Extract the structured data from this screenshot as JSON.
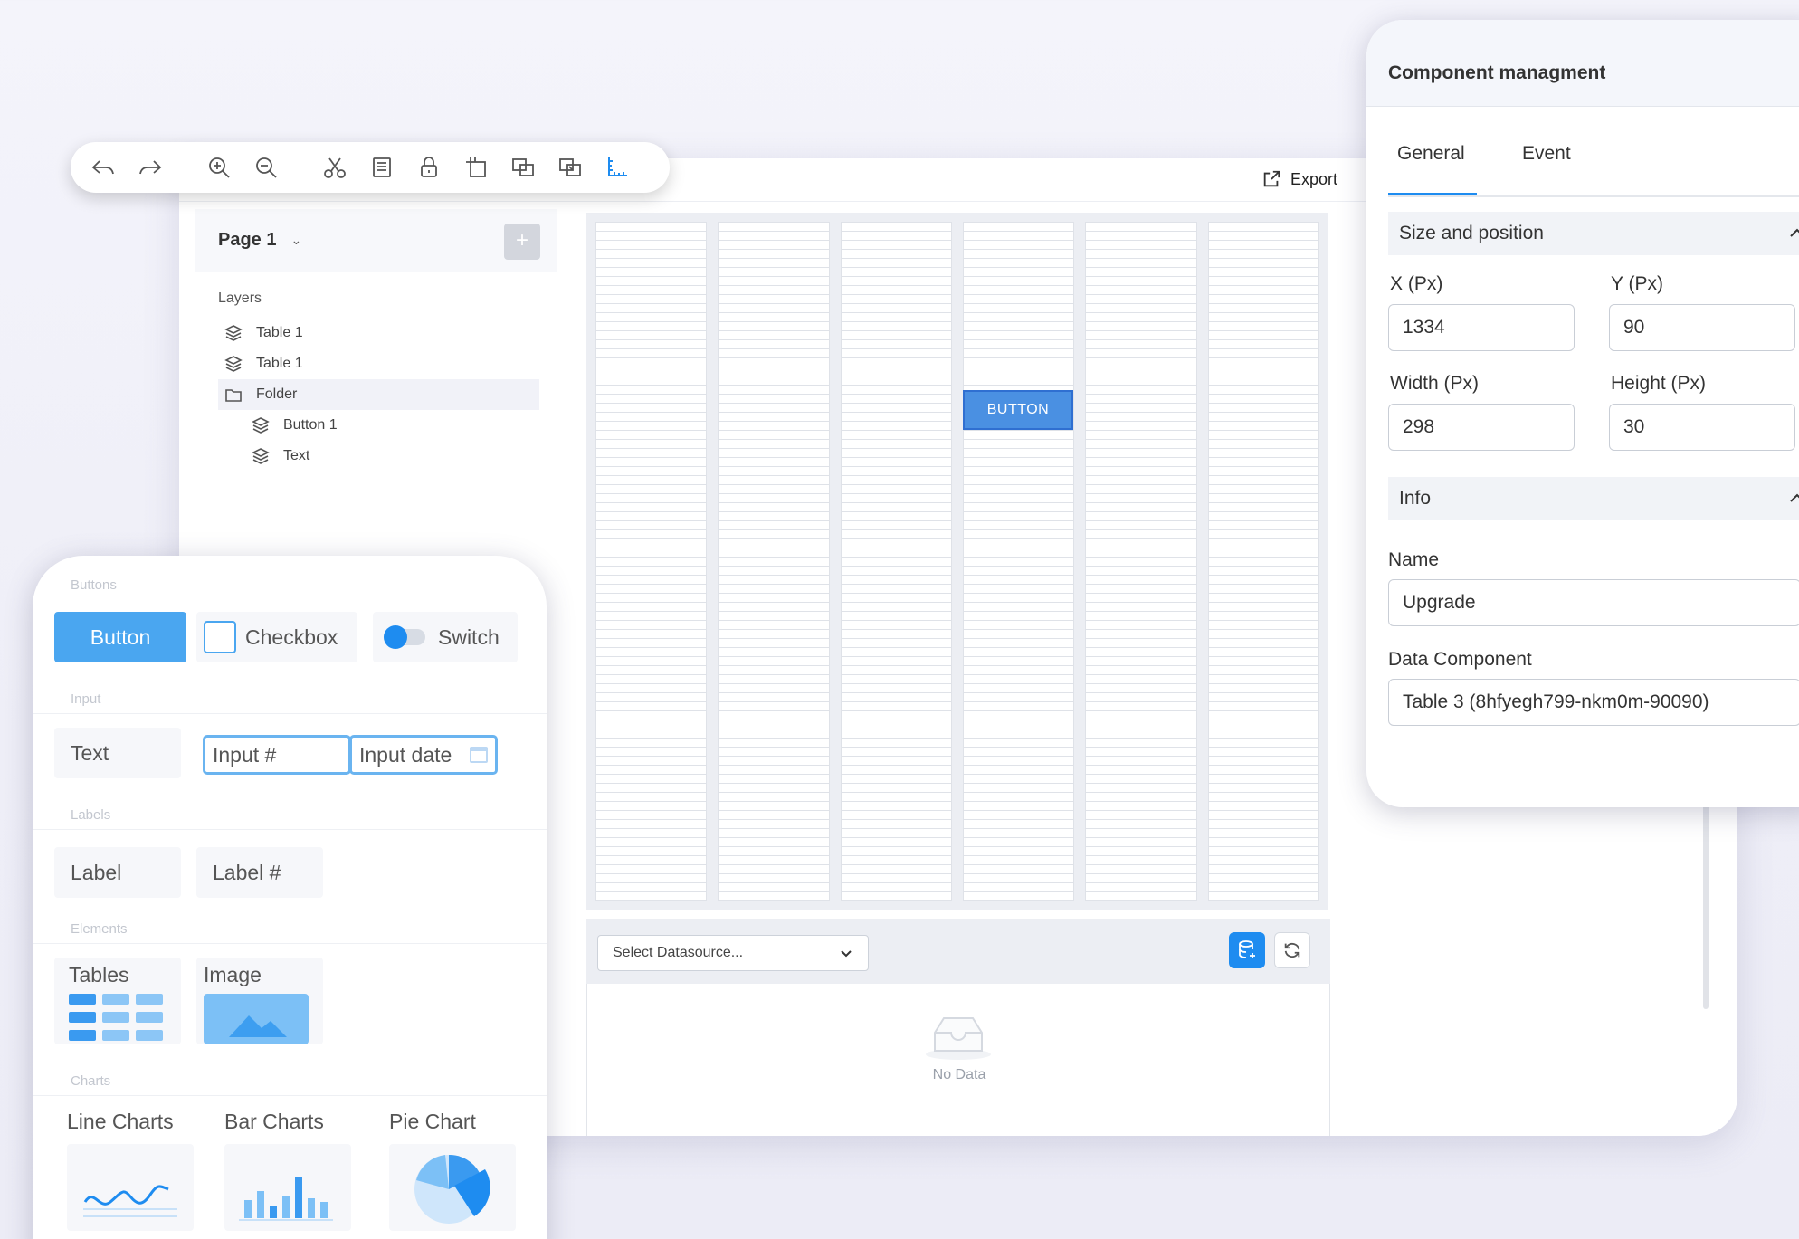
{
  "toolbar": {
    "tools": [
      "undo-icon",
      "redo-icon",
      "zoom-in-icon",
      "zoom-out-icon",
      "cut-icon",
      "notes-icon",
      "lock-icon",
      "crop-icon",
      "bring-front-icon",
      "send-back-icon",
      "ruler-icon"
    ]
  },
  "editor": {
    "export_label": "Export",
    "page_label": "Page 1",
    "layers_label": "Layers",
    "layers": [
      {
        "label": "Table 1",
        "icon": "layers-icon",
        "indent": 0,
        "selected": false
      },
      {
        "label": "Table 1",
        "icon": "layers-icon",
        "indent": 0,
        "selected": false
      },
      {
        "label": "Folder",
        "icon": "folder-icon",
        "indent": 0,
        "selected": true
      },
      {
        "label": "Button 1",
        "icon": "layers-icon",
        "indent": 1,
        "selected": false
      },
      {
        "label": "Text",
        "icon": "layers-icon",
        "indent": 1,
        "selected": false
      }
    ],
    "canvas_button": "BUTTON",
    "datasource_placeholder": "Select Datasource...",
    "no_data": "No Data"
  },
  "component_management": {
    "title": "Component managment",
    "tabs": [
      {
        "label": "General",
        "active": true
      },
      {
        "label": "Event",
        "active": false
      }
    ],
    "size_section": "Size and position",
    "x_label": "X (Px)",
    "x_value": "1334",
    "y_label": "Y (Px)",
    "y_value": "90",
    "w_label": "Width (Px)",
    "w_value": "298",
    "h_label": "Height (Px)",
    "h_value": "30",
    "info_section": "Info",
    "name_label": "Name",
    "name_value": "Upgrade",
    "data_label": "Data Component",
    "data_value": "Table 3 (8hfyegh799-nkm0m-90090)"
  },
  "palette": {
    "buttons_section": "Buttons",
    "button": "Button",
    "checkbox": "Checkbox",
    "switch": "Switch",
    "input_section": "Input",
    "text": "Text",
    "input_number": "Input #",
    "input_date": "Input date",
    "labels_section": "Labels",
    "label": "Label",
    "label_number": "Label #",
    "elements_section": "Elements",
    "tables": "Tables",
    "image": "Image",
    "charts_section": "Charts",
    "line_charts": "Line Charts",
    "bar_charts": "Bar Charts",
    "pie_chart": "Pie Chart"
  },
  "colors": {
    "accent": "#1e8cf0",
    "canvas_button": "#4a90e2",
    "palette_button": "#4aa6f0"
  }
}
